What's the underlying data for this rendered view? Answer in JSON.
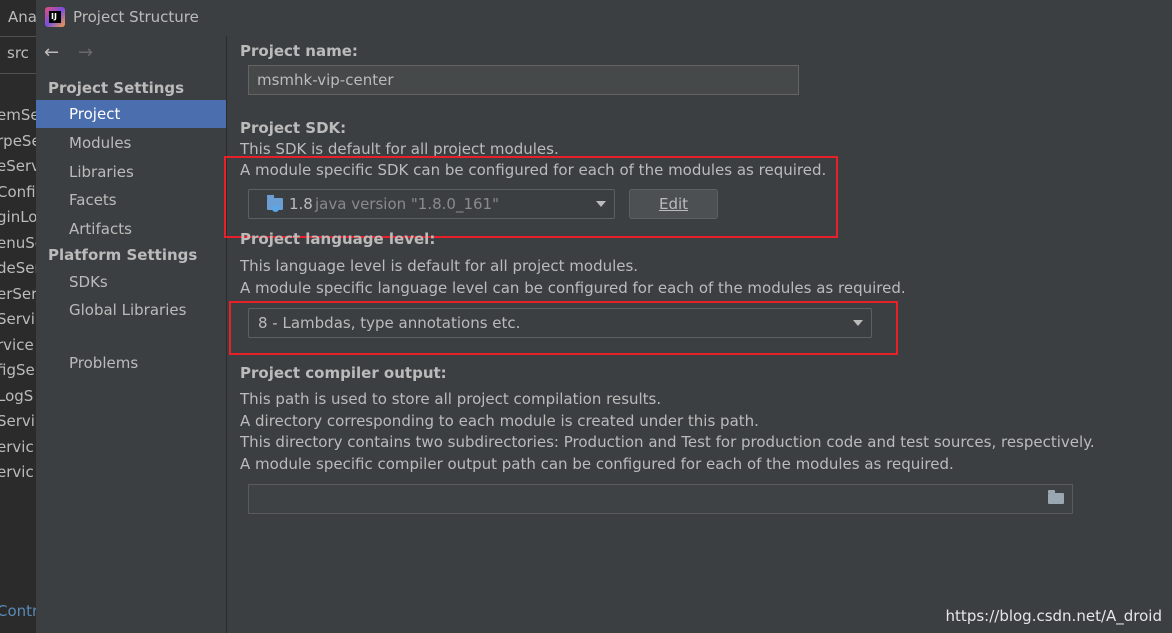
{
  "background": {
    "menu_fragment": "Ana",
    "src_tab": "src",
    "file_list": [
      "emSe",
      "rpeSe",
      "eServ",
      "Config",
      "ginLo",
      "enuSe",
      "deSer",
      "erSer",
      "Servi",
      "rvice",
      "figSe",
      "LogS",
      "Servi",
      "ervic",
      "ervic"
    ],
    "bottom_fragment": "Contr"
  },
  "window": {
    "title": "Project Structure",
    "app_icon": "intellij-icon"
  },
  "sidebar": {
    "back_icon": "←",
    "forward_icon": "→",
    "project_settings_heading": "Project Settings",
    "project_settings_items": [
      {
        "label": "Project",
        "selected": true
      },
      {
        "label": "Modules"
      },
      {
        "label": "Libraries"
      },
      {
        "label": "Facets"
      },
      {
        "label": "Artifacts"
      }
    ],
    "platform_settings_heading": "Platform Settings",
    "platform_settings_items": [
      {
        "label": "SDKs"
      },
      {
        "label": "Global Libraries"
      }
    ],
    "problems_label": "Problems"
  },
  "project_name": {
    "label": "Project name:",
    "value": "msmhk-vip-center"
  },
  "project_sdk": {
    "label": "Project SDK:",
    "desc1": "This SDK is default for all project modules.",
    "desc2": "A module specific SDK can be configured for each of the modules as required.",
    "sdk_version": "1.8",
    "sdk_detail": "java version \"1.8.0_161\"",
    "edit_button": "Edit"
  },
  "language_level": {
    "label": "Project language level:",
    "desc1": "This language level is default for all project modules.",
    "desc2": "A module specific language level can be configured for each of the modules as required.",
    "value": "8 - Lambdas, type annotations etc."
  },
  "compiler_output": {
    "label": "Project compiler output:",
    "desc1": "This path is used to store all project compilation results.",
    "desc2": "A directory corresponding to each module is created under this path.",
    "desc3": "This directory contains two subdirectories: Production and Test for production code and test sources, respectively.",
    "desc4": "A module specific compiler output path can be configured for each of the modules as required.",
    "path_value": ""
  },
  "watermark": "https://blog.csdn.net/A_droid",
  "colors": {
    "selection": "#4b6eaf",
    "annotation_red": "#e8202a",
    "background": "#3c3f41"
  }
}
